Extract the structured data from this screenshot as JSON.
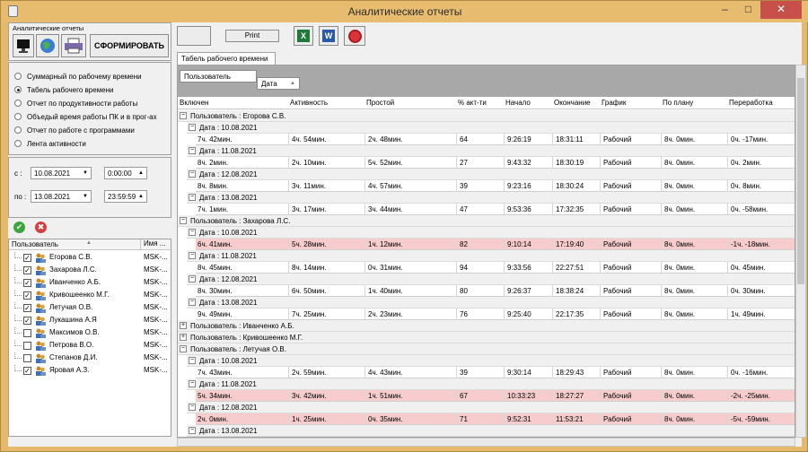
{
  "window": {
    "title": "Аналитические отчеты",
    "minimize": "–",
    "maximize": "□",
    "close": "✕"
  },
  "left": {
    "group_title": "Аналитические отчеты",
    "form_button": "СФОРМИРОВАТЬ",
    "reports": [
      {
        "label": "Суммарный по рабочему времени",
        "selected": false
      },
      {
        "label": "Табель рабочего времени",
        "selected": true
      },
      {
        "label": "Отчет по продуктивности работы",
        "selected": false
      },
      {
        "label": "Объедый время работы ПК и в прог-ах",
        "selected": false
      },
      {
        "label": "Отчет по работе с программами",
        "selected": false
      },
      {
        "label": "Лента активности",
        "selected": false
      }
    ],
    "from_label": "с :",
    "to_label": "по :",
    "date_from": "10.08.2021",
    "time_from": "0:00:00",
    "date_to": "13.08.2021",
    "time_to": "23:59:59",
    "list_headers": [
      "Пользователь",
      "Имя ..."
    ],
    "users": [
      {
        "name": "Егорова С.В.",
        "host": "MSK-...",
        "checked": true
      },
      {
        "name": "Захарова Л.С.",
        "host": "MSK-...",
        "checked": true
      },
      {
        "name": "Иванченко А.Б.",
        "host": "MSK-...",
        "checked": true
      },
      {
        "name": "Кривошеенко М.Г.",
        "host": "MSK-...",
        "checked": true
      },
      {
        "name": "Летучая О.В.",
        "host": "MSK-...",
        "checked": true
      },
      {
        "name": "Лукашина А.Я",
        "host": "MSK-...",
        "checked": true
      },
      {
        "name": "Максимов О.В.",
        "host": "MSK-...",
        "checked": false
      },
      {
        "name": "Петрова В.О.",
        "host": "MSK-...",
        "checked": false
      },
      {
        "name": "Степанов Д.И.",
        "host": "MSK-...",
        "checked": false
      },
      {
        "name": "Яровая А.З.",
        "host": "MSK-...",
        "checked": true
      }
    ]
  },
  "toolbar": {
    "print": "Print"
  },
  "tab": "Табель рабочего времени",
  "grouping": {
    "chip1": "Пользователь",
    "chip2": "Дата"
  },
  "columns": [
    "Включен",
    "Активность",
    "Простой",
    "% акт-ти",
    "Начало",
    "Окончание",
    "График",
    "По плану",
    "Переработка"
  ],
  "groups": [
    {
      "user": "Пользователь : Егорова С.В.",
      "expanded": true,
      "days": [
        {
          "date": "Дата : 10.08.2021",
          "row": [
            "7ч. 42мин.",
            "4ч. 54мин.",
            "2ч. 48мин.",
            "64",
            "9:26:19",
            "18:31:11",
            "Рабочий",
            "8ч. 0мин.",
            "0ч. -17мин."
          ],
          "pink": false
        },
        {
          "date": "Дата : 11.08.2021",
          "row": [
            "8ч. 2мин.",
            "2ч. 10мин.",
            "5ч. 52мин.",
            "27",
            "9:43:32",
            "18:30:19",
            "Рабочий",
            "8ч. 0мин.",
            "0ч. 2мин."
          ],
          "pink": false
        },
        {
          "date": "Дата : 12.08.2021",
          "row": [
            "8ч. 8мин.",
            "3ч. 11мин.",
            "4ч. 57мин.",
            "39",
            "9:23:16",
            "18:30:24",
            "Рабочий",
            "8ч. 0мин.",
            "0ч. 8мин."
          ],
          "pink": false
        },
        {
          "date": "Дата : 13.08.2021",
          "row": [
            "7ч. 1мин.",
            "3ч. 17мин.",
            "3ч. 44мин.",
            "47",
            "9:53:36",
            "17:32:35",
            "Рабочий",
            "8ч. 0мин.",
            "0ч. -58мин."
          ],
          "pink": false
        }
      ]
    },
    {
      "user": "Пользователь : Захарова Л.С.",
      "expanded": true,
      "days": [
        {
          "date": "Дата : 10.08.2021",
          "row": [
            "6ч. 41мин.",
            "5ч. 28мин.",
            "1ч. 12мин.",
            "82",
            "9:10:14",
            "17:19:40",
            "Рабочий",
            "8ч. 0мин.",
            "-1ч. -18мин."
          ],
          "pink": true
        },
        {
          "date": "Дата : 11.08.2021",
          "row": [
            "8ч. 45мин.",
            "8ч. 14мин.",
            "0ч. 31мин.",
            "94",
            "9:33:56",
            "22:27:51",
            "Рабочий",
            "8ч. 0мин.",
            "0ч. 45мин."
          ],
          "pink": false
        },
        {
          "date": "Дата : 12.08.2021",
          "row": [
            "8ч. 30мин.",
            "6ч. 50мин.",
            "1ч. 40мин.",
            "80",
            "9:26:37",
            "18:38:24",
            "Рабочий",
            "8ч. 0мин.",
            "0ч. 30мин."
          ],
          "pink": false
        },
        {
          "date": "Дата : 13.08.2021",
          "row": [
            "9ч. 49мин.",
            "7ч. 25мин.",
            "2ч. 23мин.",
            "76",
            "9:25:40",
            "22:17:35",
            "Рабочий",
            "8ч. 0мин.",
            "1ч. 49мин."
          ],
          "pink": false
        }
      ]
    },
    {
      "user": "Пользователь : Иванченко А.Б.",
      "expanded": false,
      "days": []
    },
    {
      "user": "Пользователь : Кривошеенко М.Г.",
      "expanded": false,
      "days": []
    },
    {
      "user": "Пользователь : Летучая О.В.",
      "expanded": true,
      "days": [
        {
          "date": "Дата : 10.08.2021",
          "row": [
            "7ч. 43мин.",
            "2ч. 59мин.",
            "4ч. 43мин.",
            "39",
            "9:30:14",
            "18:29:43",
            "Рабочий",
            "8ч. 0мин.",
            "0ч. -16мин."
          ],
          "pink": false
        },
        {
          "date": "Дата : 11.08.2021",
          "row": [
            "5ч. 34мин.",
            "3ч. 42мин.",
            "1ч. 51мин.",
            "67",
            "10:33:23",
            "18:27:27",
            "Рабочий",
            "8ч. 0мин.",
            "-2ч. -25мин."
          ],
          "pink": true
        },
        {
          "date": "Дата : 12.08.2021",
          "row": [
            "2ч. 0мин.",
            "1ч. 25мин.",
            "0ч. 35мин.",
            "71",
            "9:52:31",
            "11:53:21",
            "Рабочий",
            "8ч. 0мин.",
            "-5ч. -59мин."
          ],
          "pink": true
        },
        {
          "date": "Дата : 13.08.2021",
          "row": null,
          "pink": false
        }
      ]
    }
  ]
}
